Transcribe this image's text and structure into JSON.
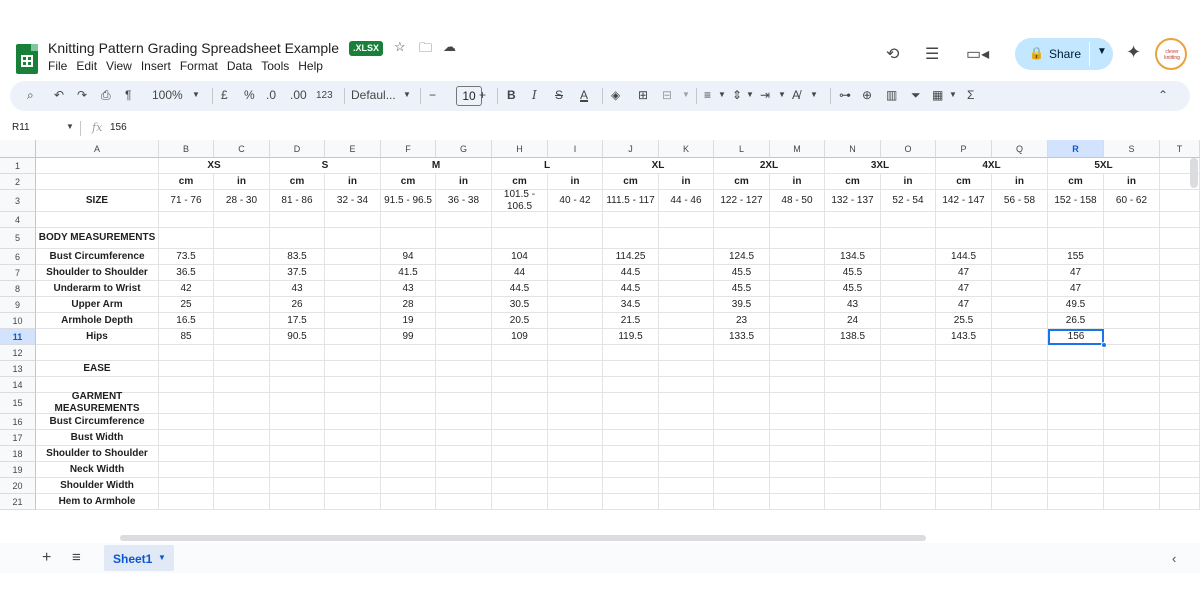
{
  "app": {
    "title": "Knitting Pattern Grading Spreadsheet Example",
    "badge": ".XLSX",
    "menu": [
      "File",
      "Edit",
      "View",
      "Insert",
      "Format",
      "Data",
      "Tools",
      "Help"
    ],
    "share_label": "Share",
    "avatar_text": "clever knitting"
  },
  "toolbar": {
    "zoom": "100%",
    "currency": "£",
    "percent": "%",
    "dec_decrease": ".0",
    "dec_increase": ".00",
    "number_format": "123",
    "font": "Defaul...",
    "font_size": "10"
  },
  "formula": {
    "cell_ref": "R11",
    "fx": "fx",
    "value": "156"
  },
  "columns": [
    "A",
    "B",
    "C",
    "D",
    "E",
    "F",
    "G",
    "H",
    "I",
    "J",
    "K",
    "L",
    "M",
    "N",
    "O",
    "P",
    "Q",
    "R",
    "S",
    "T"
  ],
  "rows": [
    "1",
    "2",
    "3",
    "4",
    "5",
    "6",
    "7",
    "8",
    "9",
    "10",
    "11",
    "12",
    "13",
    "14",
    "15",
    "16",
    "17",
    "18",
    "19",
    "20",
    "21"
  ],
  "sizes": [
    "XS",
    "S",
    "M",
    "L",
    "XL",
    "2XL",
    "3XL",
    "4XL",
    "5XL"
  ],
  "unit_headers": [
    "cm",
    "in",
    "cm",
    "in",
    "cm",
    "in",
    "cm",
    "in",
    "cm",
    "in",
    "cm",
    "in",
    "cm",
    "in",
    "cm",
    "in",
    "cm",
    "in"
  ],
  "size_label": "SIZE",
  "size_ranges": [
    "71 - 76",
    "28 - 30",
    "81 - 86",
    "32 - 34",
    "91.5 - 96.5",
    "36 - 38",
    "101.5 - 106.5",
    "40 - 42",
    "111.5 - 117",
    "44 - 46",
    "122 - 127",
    "48 - 50",
    "132 - 137",
    "52 - 54",
    "142 - 147",
    "56 - 58",
    "152 - 158",
    "60 - 62"
  ],
  "body_heading": "BODY MEASUREMENTS",
  "body_rows": [
    {
      "label": "Bust Circumference",
      "values": [
        "73.5",
        "83.5",
        "94",
        "104",
        "114.25",
        "124.5",
        "134.5",
        "144.5",
        "155"
      ]
    },
    {
      "label": "Shoulder to Shoulder",
      "values": [
        "36.5",
        "37.5",
        "41.5",
        "44",
        "44.5",
        "45.5",
        "45.5",
        "47",
        "47"
      ]
    },
    {
      "label": "Underarm to Wrist",
      "values": [
        "42",
        "43",
        "43",
        "44.5",
        "44.5",
        "45.5",
        "45.5",
        "47",
        "47"
      ]
    },
    {
      "label": "Upper Arm",
      "values": [
        "25",
        "26",
        "28",
        "30.5",
        "34.5",
        "39.5",
        "43",
        "47",
        "49.5"
      ]
    },
    {
      "label": "Armhole Depth",
      "values": [
        "16.5",
        "17.5",
        "19",
        "20.5",
        "21.5",
        "23",
        "24",
        "25.5",
        "26.5"
      ]
    },
    {
      "label": "Hips",
      "values": [
        "85",
        "90.5",
        "99",
        "109",
        "119.5",
        "133.5",
        "138.5",
        "143.5",
        "156"
      ]
    }
  ],
  "ease_label": "EASE",
  "garment_heading": "GARMENT MEASUREMENTS",
  "garment_rows": [
    "Bust Circumference",
    "Bust Width",
    "Shoulder to Shoulder",
    "Neck Width",
    "Shoulder Width",
    "Hem to Armhole"
  ],
  "sheet_tab": "Sheet1"
}
